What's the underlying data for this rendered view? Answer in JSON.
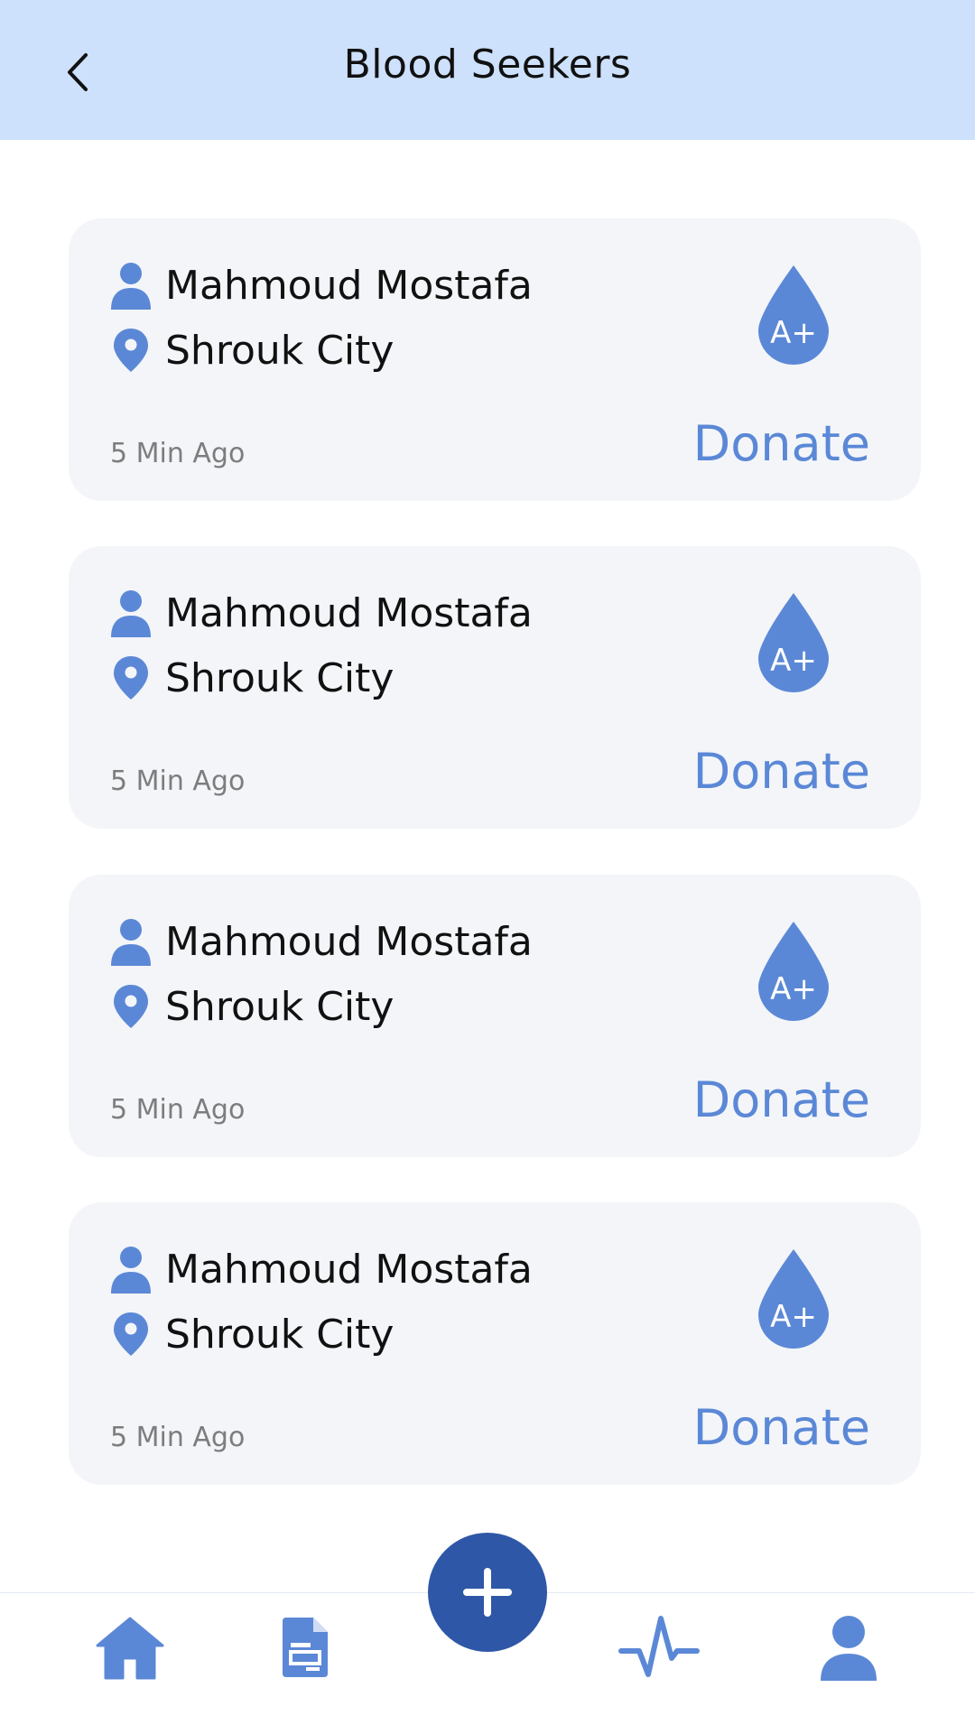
{
  "header": {
    "title": "Blood Seekers",
    "back_icon": "chevron-left-icon"
  },
  "requests": [
    {
      "name": "Mahmoud Mostafa",
      "location": "Shrouk City",
      "time": "5 Min Ago",
      "blood_type": "A+",
      "action_label": "Donate"
    },
    {
      "name": "Mahmoud Mostafa",
      "location": "Shrouk City",
      "time": "5 Min Ago",
      "blood_type": "A+",
      "action_label": "Donate"
    },
    {
      "name": "Mahmoud Mostafa",
      "location": "Shrouk City",
      "time": "5 Min Ago",
      "blood_type": "A+",
      "action_label": "Donate"
    },
    {
      "name": "Mahmoud Mostafa",
      "location": "Shrouk City",
      "time": "5 Min Ago",
      "blood_type": "A+",
      "action_label": "Donate"
    }
  ],
  "bottom_nav": {
    "items": [
      "home-icon",
      "document-icon",
      "add-icon",
      "activity-icon",
      "profile-icon"
    ]
  },
  "colors": {
    "header_bg": "#cde1fc",
    "accent": "#5b88d6",
    "fab": "#2e57a7",
    "card_bg": "#f3f5f9"
  }
}
